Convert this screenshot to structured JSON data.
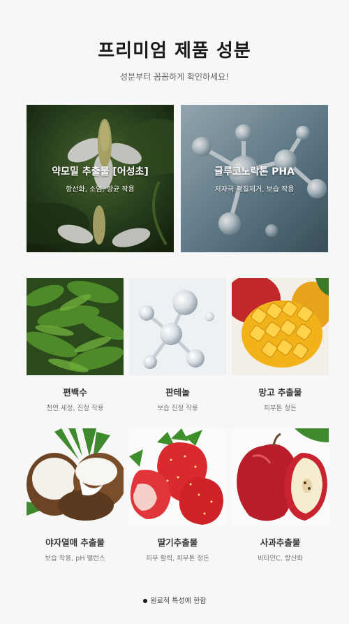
{
  "header": {
    "title": "프리미엄 제품 성분",
    "subtitle": "성분부터 꼼꼼하게 확인하세요!"
  },
  "featured": [
    {
      "name": "약모밀 추출물 [어성초]",
      "desc": "항산화, 소염, 항균 작용",
      "image_icon": "houttuynia-flower-photo"
    },
    {
      "name": "글루코노락톤 PHA",
      "desc": "저자극 각질제거, 보습 작용",
      "image_icon": "molecule-model-photo"
    }
  ],
  "ingredients": [
    {
      "name": "편백수",
      "desc": "천연 세정, 진정 작용",
      "image_icon": "cypress-leaves-photo"
    },
    {
      "name": "판테놀",
      "desc": "보습 진정 작용",
      "image_icon": "molecule-photo"
    },
    {
      "name": "망고 추출물",
      "desc": "피부톤 정돈",
      "image_icon": "mango-photo"
    },
    {
      "name": "야자열매 추출물",
      "desc": "보습 작용, pH 밸런스",
      "image_icon": "coconut-photo"
    },
    {
      "name": "딸기추출물",
      "desc": "피부 활력, 피부톤 정돈",
      "image_icon": "strawberry-photo"
    },
    {
      "name": "사과추출물",
      "desc": "비타민C, 항산화",
      "image_icon": "apple-photo"
    }
  ],
  "footer_note": "원료적 특성에 한함"
}
